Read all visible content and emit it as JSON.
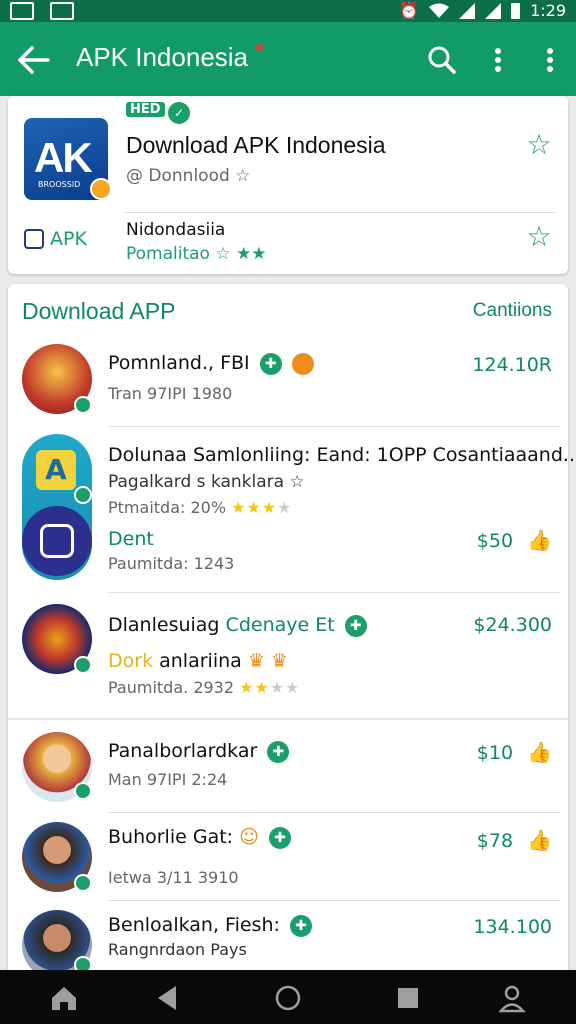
{
  "status_bar": {
    "time": "1:29"
  },
  "app_bar": {
    "title": "APK Indonesia"
  },
  "header_card": {
    "badge_text": "HED",
    "logo_letters": "AK",
    "logo_sub": "BROOSSID",
    "title": "Download APK Indonesia",
    "subtitle": "@ Donnlood ☆",
    "brand_label": "APK",
    "row2_title": "Nidondasiia",
    "row2_sub": "Pomalitao ☆ ★★"
  },
  "section": {
    "title": "Download APP",
    "link": "Cantiions",
    "items": [
      {
        "title": "Pomnland., FBI",
        "sub": "Tran 97IPI 1980",
        "price": "124.10R"
      },
      {
        "title": "Dolunaa Samlonliing: Eand: 1OPP Cosantiaaand......",
        "sub": "Pagalkard s kanklara ☆",
        "sub2": "Ptmaitda: 20%",
        "price": ""
      },
      {
        "title": "Dent",
        "sub": "Paumitda: 1243",
        "price": "$50"
      },
      {
        "title": "Dlanlesuiag",
        "title_accent": "Cdenaye Et",
        "sub_gold": "Dork",
        "sub_rest": "anlariina",
        "sub2": "Paumitda. 2932",
        "price": "$24.300"
      },
      {
        "title": "Panalborlardkar",
        "sub": "Man 97IPI 2:24",
        "price": "$10"
      },
      {
        "title": "Buhorlie Gat:",
        "sub": "Ietwa 3/11 3910",
        "price": "$78"
      },
      {
        "title": "Benloalkan, Fiesh:",
        "sub": "Rangnrdaon Pays",
        "price": "134.100"
      }
    ]
  },
  "colors": {
    "primary": "#129a68",
    "accent": "#11895a",
    "star": "#f5c518"
  }
}
